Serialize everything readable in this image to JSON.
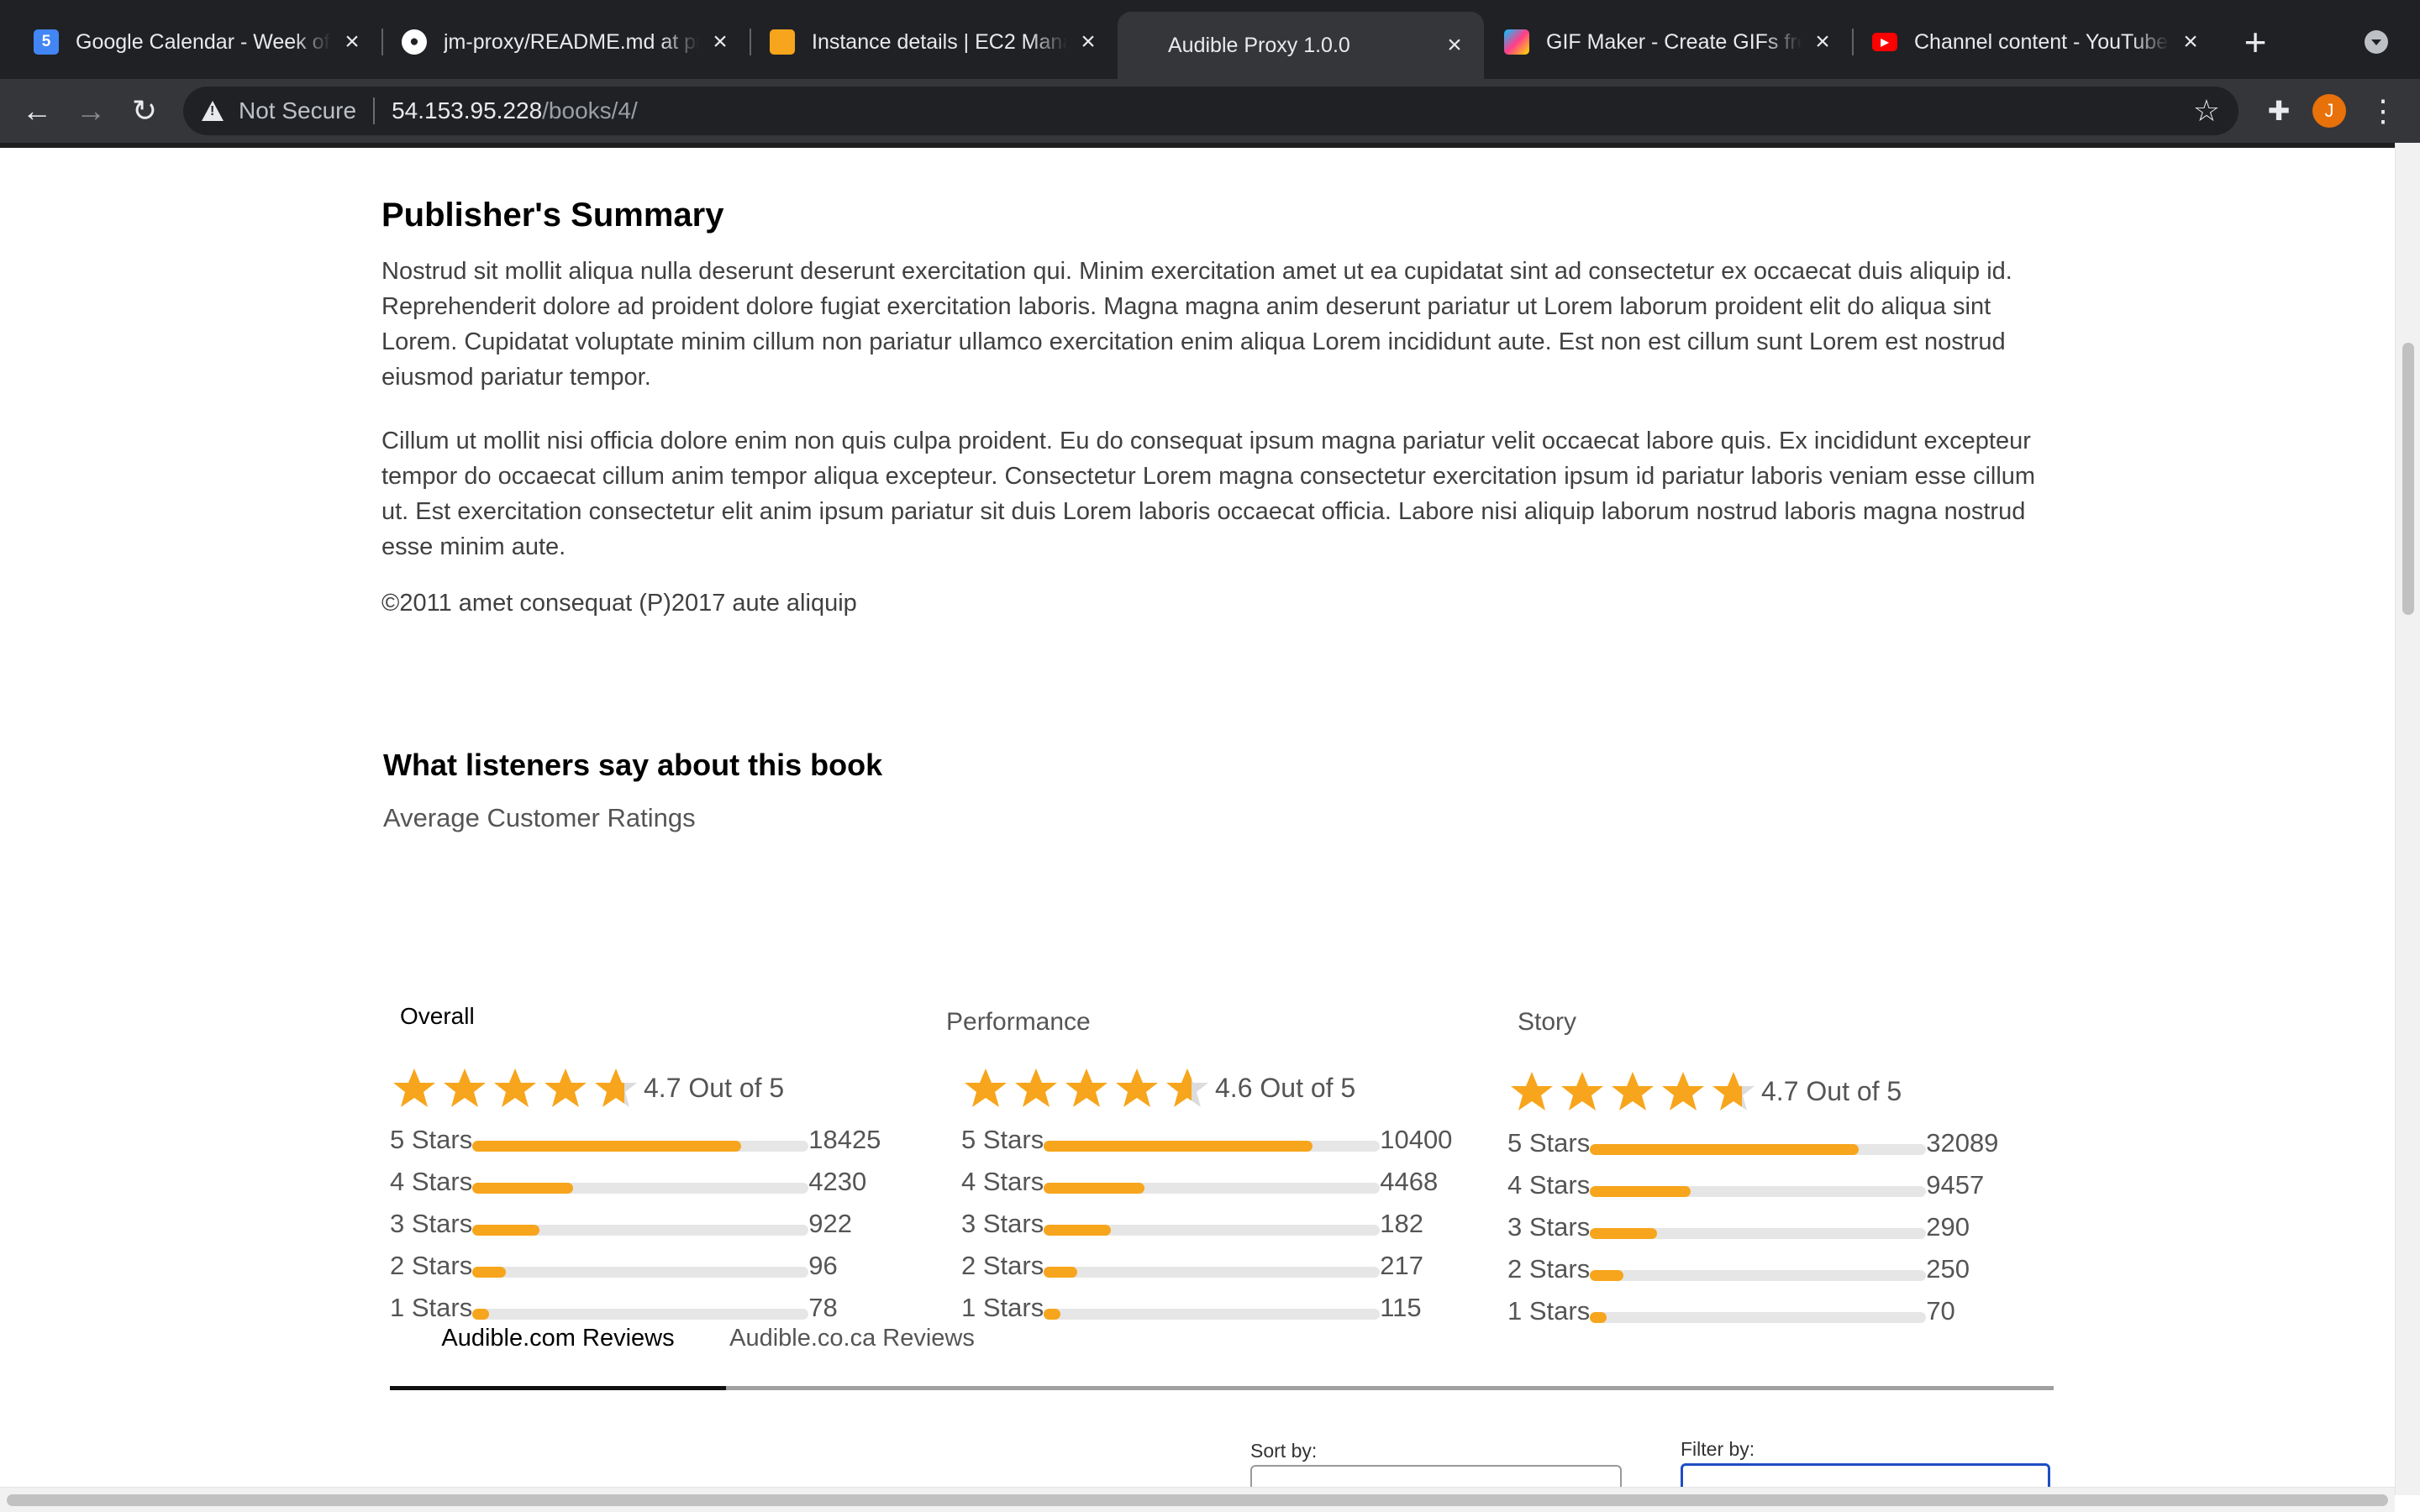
{
  "browser": {
    "tabs": [
      {
        "title": "Google Calendar - Week of",
        "icon": "google-calendar-icon",
        "icon_color": "#4285f4"
      },
      {
        "title": "jm-proxy/README.md at pr",
        "icon": "github-icon",
        "icon_color": "#ffffff"
      },
      {
        "title": "Instance details | EC2 Mana",
        "icon": "aws-icon",
        "icon_color": "#f7a51c"
      },
      {
        "title": "Audible Proxy 1.0.0",
        "icon": "",
        "icon_color": ""
      },
      {
        "title": "GIF Maker - Create GIFs fro",
        "icon": "gif-maker-icon",
        "icon_color": "#e8eaed"
      },
      {
        "title": "Channel content - YouTube",
        "icon": "youtube-icon",
        "icon_color": "#ff0000"
      }
    ],
    "security_label": "Not Secure",
    "url_host": "54.153.95.228",
    "url_path": "/books/4/",
    "avatar_letter": "J"
  },
  "summary": {
    "title": "Publisher's Summary",
    "paragraphs": [
      "Nostrud sit mollit aliqua nulla deserunt deserunt exercitation qui. Minim exercitation amet ut ea cupidatat sint ad consectetur ex occaecat duis aliquip id. Reprehenderit dolore ad proident dolore fugiat exercitation laboris. Magna magna anim deserunt pariatur ut Lorem laborum proident elit do aliqua sint Lorem. Cupidatat voluptate minim cillum non pariatur ullamco exercitation enim aliqua Lorem incididunt aute. Est non est cillum sunt Lorem est nostrud eiusmod pariatur tempor.",
      "Cillum ut mollit nisi officia dolore enim non quis culpa proident. Eu do consequat ipsum magna pariatur velit occaecat labore quis. Ex incididunt excepteur tempor do occaecat cillum anim tempor aliqua excepteur. Consectetur Lorem magna consectetur exercitation ipsum id pariatur laboris veniam esse cillum ut. Est exercitation consectetur elit anim ipsum pariatur sit duis Lorem laboris occaecat officia. Labore nisi aliquip laborum nostrud laboris magna nostrud esse minim aute."
    ],
    "copyright": "©2011 amet consequat (P)2017 aute aliquip"
  },
  "ratings": {
    "title": "What listeners say about this book",
    "subtitle": "Average Customer Ratings",
    "star_color": "#f7a51c",
    "categories": [
      {
        "label": "Overall",
        "score": 4.7,
        "score_text": "4.7 Out of 5",
        "rows": [
          {
            "label": "5 Stars",
            "count": "18425",
            "fraction": 0.8
          },
          {
            "label": "4 Stars",
            "count": "4230",
            "fraction": 0.3
          },
          {
            "label": "3 Stars",
            "count": "922",
            "fraction": 0.2
          },
          {
            "label": "2 Stars",
            "count": "96",
            "fraction": 0.1
          },
          {
            "label": "1 Stars",
            "count": "78",
            "fraction": 0.05
          }
        ]
      },
      {
        "label": "Performance",
        "score": 4.6,
        "score_text": "4.6 Out of 5",
        "rows": [
          {
            "label": "5 Stars",
            "count": "10400",
            "fraction": 0.8
          },
          {
            "label": "4 Stars",
            "count": "4468",
            "fraction": 0.3
          },
          {
            "label": "3 Stars",
            "count": "182",
            "fraction": 0.2
          },
          {
            "label": "2 Stars",
            "count": "217",
            "fraction": 0.1
          },
          {
            "label": "1 Stars",
            "count": "115",
            "fraction": 0.05
          }
        ]
      },
      {
        "label": "Story",
        "score": 4.7,
        "score_text": "4.7 Out of 5",
        "rows": [
          {
            "label": "5 Stars",
            "count": "32089",
            "fraction": 0.8
          },
          {
            "label": "4 Stars",
            "count": "9457",
            "fraction": 0.3
          },
          {
            "label": "3 Stars",
            "count": "290",
            "fraction": 0.2
          },
          {
            "label": "2 Stars",
            "count": "250",
            "fraction": 0.1
          },
          {
            "label": "1 Stars",
            "count": "70",
            "fraction": 0.05
          }
        ]
      }
    ]
  },
  "reviews": {
    "tabs": [
      "Audible.com Reviews",
      "Audible.co.ca Reviews"
    ],
    "sort_label": "Sort by:",
    "filter_label": "Filter by:"
  }
}
